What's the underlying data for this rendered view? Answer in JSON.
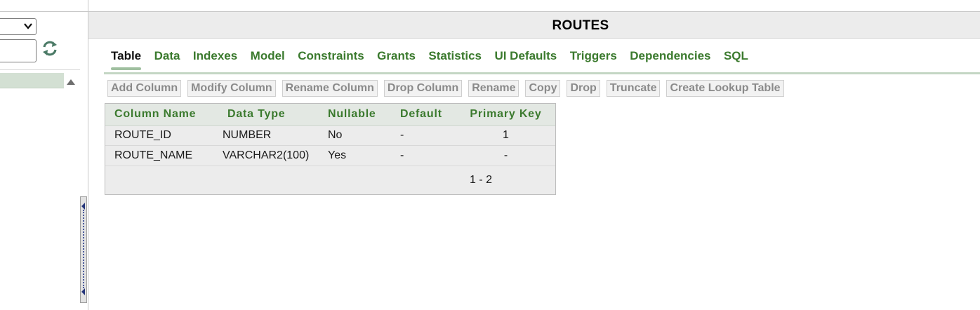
{
  "sidebar": {
    "object_select_value": "",
    "filter_value": "",
    "selected_row_label": ""
  },
  "header": {
    "title": "ROUTES"
  },
  "tabs": [
    {
      "label": "Table",
      "active": true
    },
    {
      "label": "Data"
    },
    {
      "label": "Indexes"
    },
    {
      "label": "Model"
    },
    {
      "label": "Constraints"
    },
    {
      "label": "Grants"
    },
    {
      "label": "Statistics"
    },
    {
      "label": "UI Defaults"
    },
    {
      "label": "Triggers"
    },
    {
      "label": "Dependencies"
    },
    {
      "label": "SQL"
    }
  ],
  "toolbar": {
    "buttons": [
      "Add Column",
      "Modify Column",
      "Rename Column",
      "Drop Column",
      "Rename",
      "Copy",
      "Drop",
      "Truncate",
      "Create Lookup Table"
    ]
  },
  "grid": {
    "columns": [
      "Column Name",
      "Data Type",
      "Nullable",
      "Default",
      "Primary Key"
    ],
    "rows": [
      [
        "ROUTE_ID",
        "NUMBER",
        "No",
        "-",
        "1"
      ],
      [
        "ROUTE_NAME",
        "VARCHAR2(100)",
        "Yes",
        "-",
        "-"
      ]
    ],
    "pagination": "1 - 2"
  },
  "colors": {
    "accent_green": "#3b7a2e",
    "disabled_text": "#8a8a8a",
    "selected_row": "#d3e0d3"
  },
  "icons": {
    "select_chevron": "chevron-down-icon",
    "refresh": "refresh-icon",
    "scroll_up": "scroll-up-arrow-icon"
  }
}
